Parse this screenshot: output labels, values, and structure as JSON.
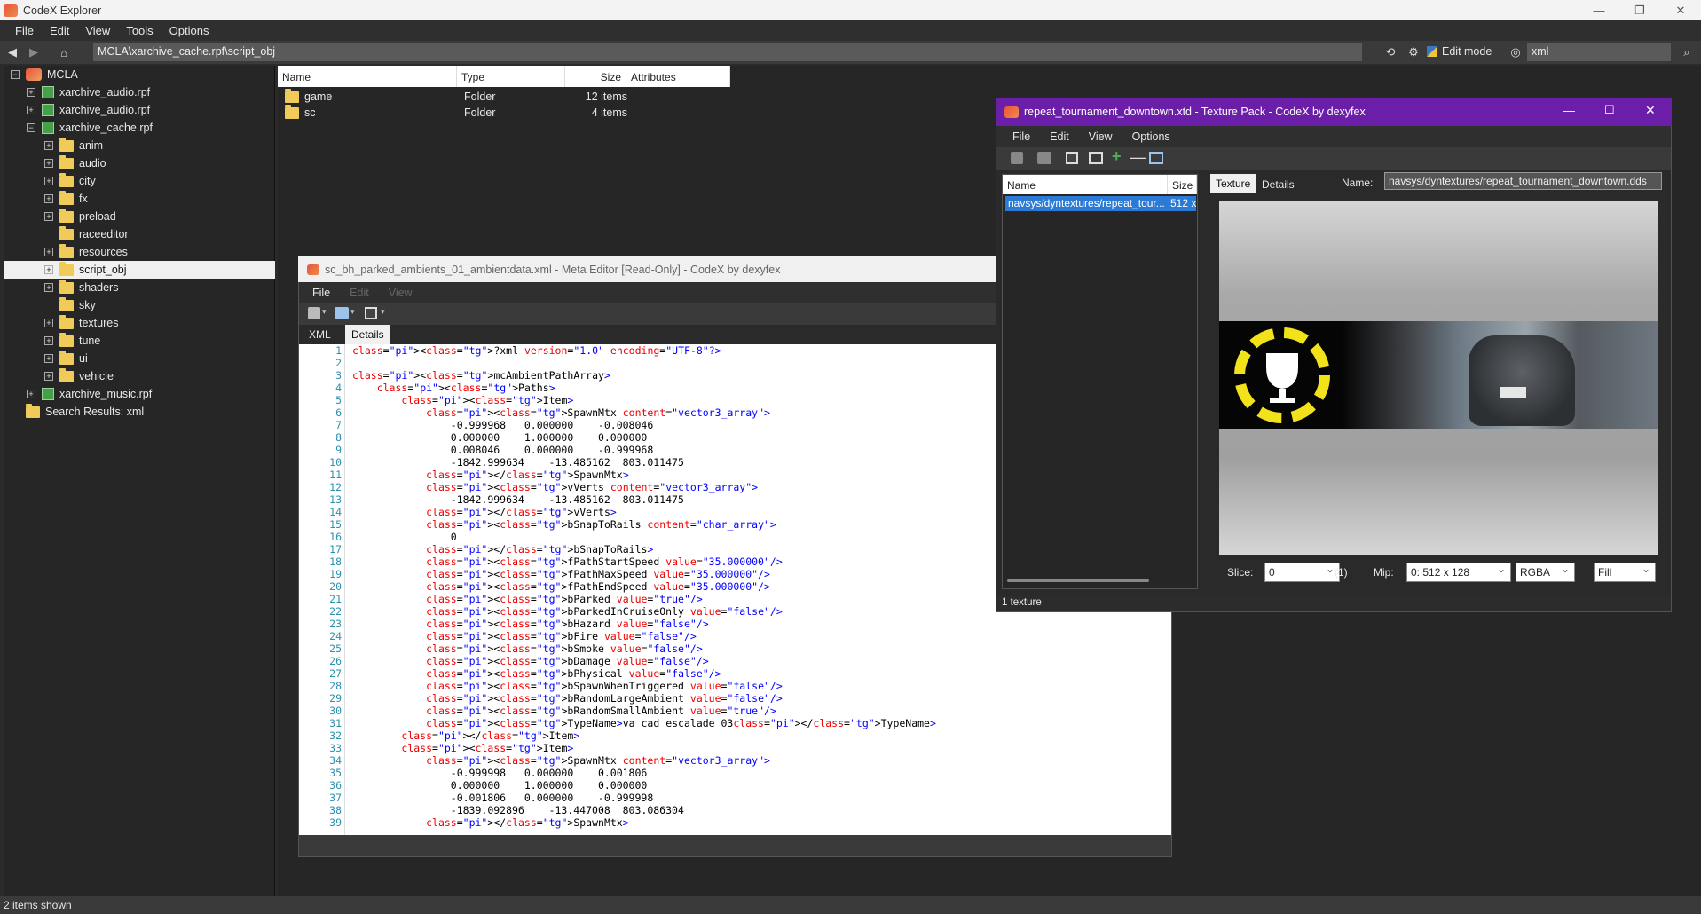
{
  "app": {
    "title": "CodeX Explorer",
    "menu": [
      "File",
      "Edit",
      "View",
      "Tools",
      "Options"
    ],
    "address": "MCLA\\xarchive_cache.rpf\\script_obj",
    "edit_mode": "Edit mode",
    "search_value": "xml",
    "status": "2 items shown"
  },
  "tree": [
    {
      "label": "MCLA",
      "type": "root",
      "expand": "−"
    },
    {
      "label": "xarchive_audio.rpf",
      "type": "rpf",
      "expand": "+"
    },
    {
      "label": "xarchive_audio.rpf",
      "type": "rpf",
      "expand": "+"
    },
    {
      "label": "xarchive_cache.rpf",
      "type": "rpf",
      "expand": "−"
    },
    {
      "label": "anim",
      "type": "folder",
      "expand": "+"
    },
    {
      "label": "audio",
      "type": "folder",
      "expand": "+"
    },
    {
      "label": "city",
      "type": "folder",
      "expand": "+"
    },
    {
      "label": "fx",
      "type": "folder",
      "expand": "+"
    },
    {
      "label": "preload",
      "type": "folder",
      "expand": "+"
    },
    {
      "label": "raceeditor",
      "type": "folder",
      "expand": ""
    },
    {
      "label": "resources",
      "type": "folder",
      "expand": "+"
    },
    {
      "label": "script_obj",
      "type": "folder",
      "expand": "+",
      "selected": true
    },
    {
      "label": "shaders",
      "type": "folder",
      "expand": "+"
    },
    {
      "label": "sky",
      "type": "folder",
      "expand": ""
    },
    {
      "label": "textures",
      "type": "folder",
      "expand": "+"
    },
    {
      "label": "tune",
      "type": "folder",
      "expand": "+"
    },
    {
      "label": "ui",
      "type": "folder",
      "expand": "+"
    },
    {
      "label": "vehicle",
      "type": "folder",
      "expand": "+"
    },
    {
      "label": "xarchive_music.rpf",
      "type": "rpf",
      "expand": "+"
    },
    {
      "label": "Search Results: xml",
      "type": "folder",
      "expand": ""
    }
  ],
  "list": {
    "columns": [
      "Name",
      "Type",
      "Size",
      "Attributes"
    ],
    "rows": [
      {
        "name": "game",
        "type": "Folder",
        "size": "12 items"
      },
      {
        "name": "sc",
        "type": "Folder",
        "size": "4 items"
      }
    ]
  },
  "meta_editor": {
    "title": "sc_bh_parked_ambients_01_ambientdata.xml - Meta Editor [Read-Only] - CodeX by dexyfex",
    "menu": [
      "File",
      "Edit",
      "View"
    ],
    "tabs": [
      "XML",
      "Details"
    ],
    "lines": [
      "<?xml version=\"1.0\" encoding=\"UTF-8\"?>",
      "",
      "<mcAmbientPathArray>",
      "    <Paths>",
      "        <Item>",
      "            <SpawnMtx content=\"vector3_array\">",
      "                -0.999968   0.000000    -0.008046",
      "                0.000000    1.000000    0.000000",
      "                0.008046    0.000000    -0.999968",
      "                -1842.999634    -13.485162  803.011475",
      "            </SpawnMtx>",
      "            <vVerts content=\"vector3_array\">",
      "                -1842.999634    -13.485162  803.011475",
      "            </vVerts>",
      "            <bSnapToRails content=\"char_array\">",
      "                0",
      "            </bSnapToRails>",
      "            <fPathStartSpeed value=\"35.000000\"/>",
      "            <fPathMaxSpeed value=\"35.000000\"/>",
      "            <fPathEndSpeed value=\"35.000000\"/>",
      "            <bParked value=\"true\"/>",
      "            <bParkedInCruiseOnly value=\"false\"/>",
      "            <bHazard value=\"false\"/>",
      "            <bFire value=\"false\"/>",
      "            <bSmoke value=\"false\"/>",
      "            <bDamage value=\"false\"/>",
      "            <bPhysical value=\"false\"/>",
      "            <bSpawnWhenTriggered value=\"false\"/>",
      "            <bRandomLargeAmbient value=\"false\"/>",
      "            <bRandomSmallAmbient value=\"true\"/>",
      "            <TypeName>va_cad_escalade_03</TypeName>",
      "        </Item>",
      "        <Item>",
      "            <SpawnMtx content=\"vector3_array\">",
      "                -0.999998   0.000000    0.001806",
      "                0.000000    1.000000    0.000000",
      "                -0.001806   0.000000    -0.999998",
      "                -1839.092896    -13.447008  803.086304",
      "            </SpawnMtx>"
    ]
  },
  "texture_pack": {
    "title": "repeat_tournament_downtown.xtd - Texture Pack - CodeX by dexyfex",
    "menu": [
      "File",
      "Edit",
      "View",
      "Options"
    ],
    "list_columns": [
      "Name",
      "Size"
    ],
    "selected_item": "navsys/dyntextures/repeat_tour...",
    "selected_size": "512 x",
    "tabs": [
      "Texture",
      "Details"
    ],
    "name_label": "Name:",
    "name_value": "navsys/dyntextures/repeat_tournament_downtown.dds",
    "slice_label": "Slice:",
    "slice_value": "0",
    "slice_count": "(1)",
    "mip_label": "Mip:",
    "mip_value": "0: 512 x 128",
    "format_value": "RGBA",
    "fill_value": "Fill",
    "status": "1 texture",
    "colors": {
      "title_bar": "#6b1fa8",
      "selection": "#2a7ad6",
      "trophy_ring": "#f2e21a"
    }
  }
}
